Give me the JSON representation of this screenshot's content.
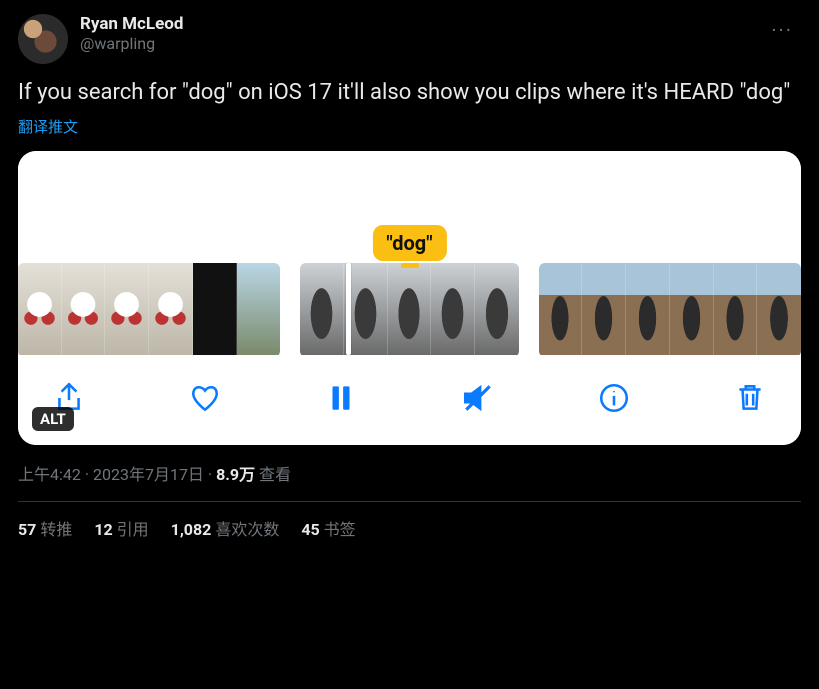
{
  "user": {
    "display_name": "Ryan McLeod",
    "handle": "@warpling"
  },
  "more_icon": "more",
  "body": "If you search for \"dog\" on iOS 17 it'll also show you clips where it's HEARD \"dog\"",
  "translate_label": "翻译推文",
  "media": {
    "tag_label": "\"dog\"",
    "alt_badge": "ALT",
    "controls": {
      "share": "share-icon",
      "like": "heart-icon",
      "pause": "pause-icon",
      "mute": "mute-icon",
      "info": "info-icon",
      "trash": "trash-icon"
    }
  },
  "meta": {
    "time": "上午4:42",
    "sep1": " · ",
    "date": "2023年7月17日",
    "sep2": " · ",
    "views_count": "8.9万",
    "views_label": " 查看"
  },
  "stats": {
    "retweet_count": "57",
    "retweet_label": " 转推",
    "quote_count": "12",
    "quote_label": " 引用",
    "like_count": "1,082",
    "like_label": " 喜欢次数",
    "bookmark_count": "45",
    "bookmark_label": " 书签"
  }
}
